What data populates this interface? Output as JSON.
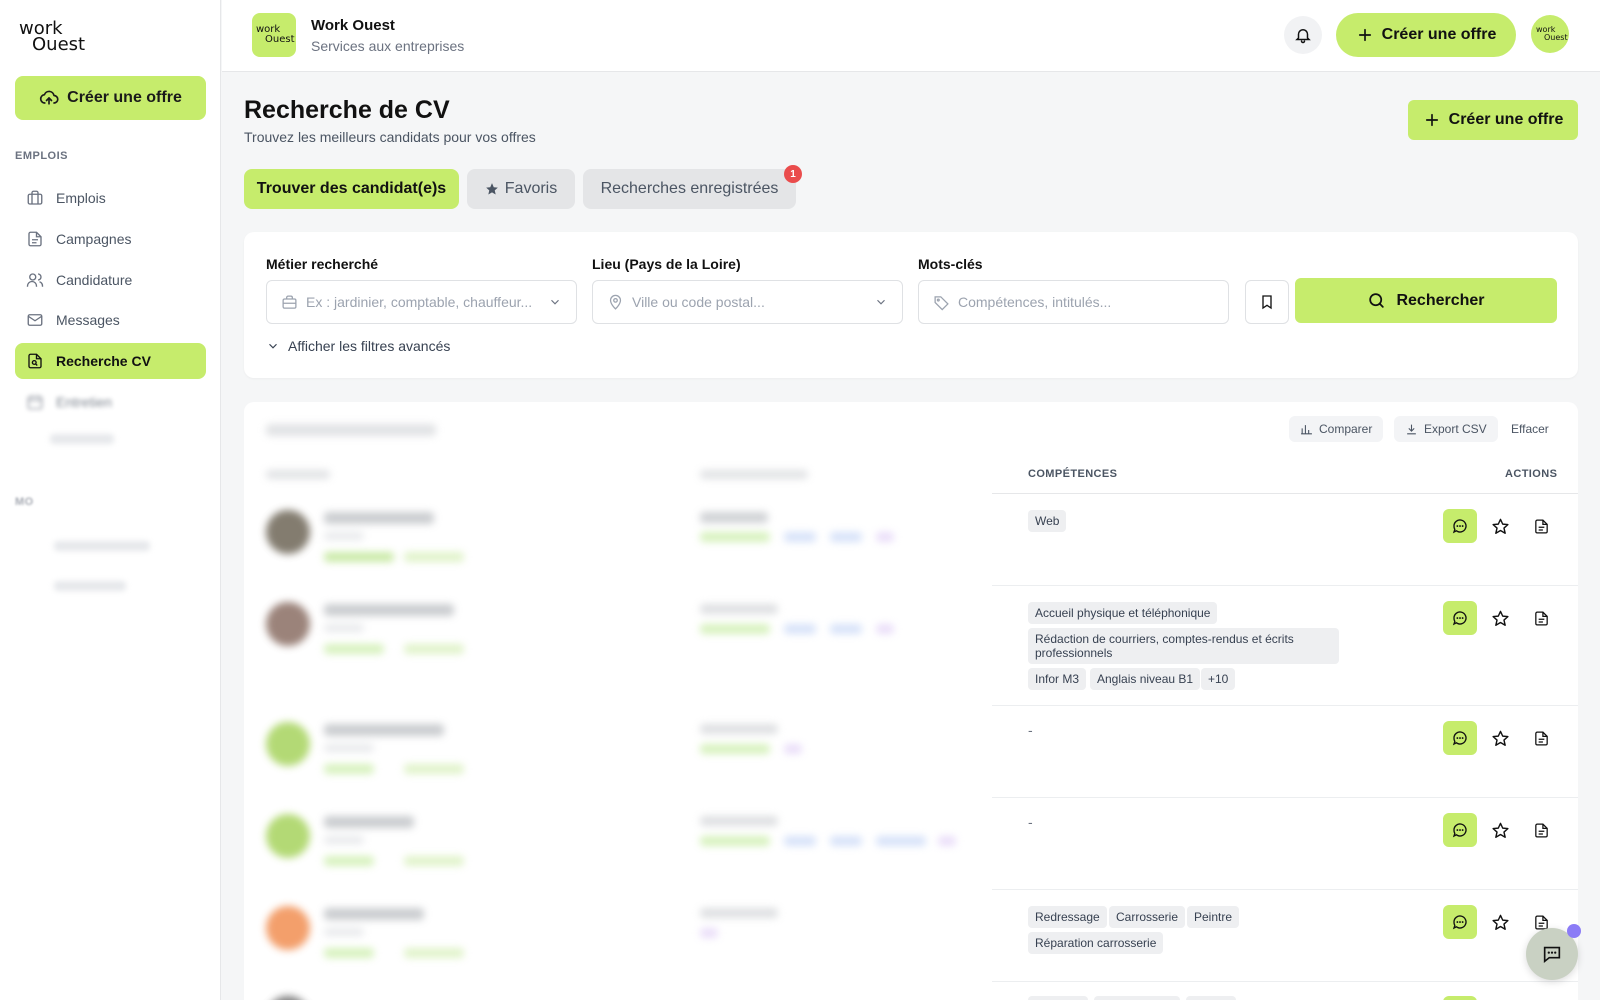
{
  "sidebar": {
    "logo_line1": "work",
    "logo_line2": "Ouest",
    "create_label": "Créer une offre",
    "section_jobs": "EMPLOIS",
    "section_account": "MO",
    "items": [
      {
        "label": "Emplois",
        "icon": "briefcase-icon"
      },
      {
        "label": "Campagnes",
        "icon": "document-icon"
      },
      {
        "label": "Candidature",
        "icon": "users-icon"
      },
      {
        "label": "Messages",
        "icon": "mail-icon"
      },
      {
        "label": "Recherche CV",
        "icon": "search-file-icon",
        "active": true
      },
      {
        "label": "Entretien",
        "icon": "calendar-icon"
      }
    ]
  },
  "header": {
    "logo_line1": "work",
    "logo_line2": "Ouest",
    "company_name": "Work Ouest",
    "company_subtitle": "Services aux entreprises",
    "create_label": "Créer une offre"
  },
  "page": {
    "title": "Recherche de CV",
    "subtitle": "Trouvez les meilleurs candidats pour vos offres",
    "create_label": "Créer une offre"
  },
  "tabs": [
    {
      "label": "Trouver des candidat(e)s",
      "active": true
    },
    {
      "label": "Favoris",
      "active": false
    },
    {
      "label": "Recherches enregistrées",
      "active": false,
      "badge": "1"
    }
  ],
  "search": {
    "job_label": "Métier recherché",
    "job_placeholder": "Ex : jardinier, comptable, chauffeur...",
    "location_label": "Lieu (Pays de la Loire)",
    "location_placeholder": "Ville ou code postal...",
    "keywords_label": "Mots-clés",
    "keywords_placeholder": "Compétences, intitulés...",
    "search_label": "Rechercher",
    "advanced_label": "Afficher les filtres avancés"
  },
  "results": {
    "compare_label": "Comparer",
    "export_label": "Export CSV",
    "clear_label": "Effacer",
    "columns": {
      "skills": "COMPÉTENCES",
      "actions": "ACTIONS"
    },
    "rows": [
      {
        "skills": [
          "Web"
        ],
        "more": ""
      },
      {
        "skills": [
          "Accueil physique et téléphonique",
          "Rédaction de courriers, comptes-rendus et écrits professionnels",
          "Infor M3",
          "Anglais niveau B1"
        ],
        "more": "+10"
      },
      {
        "skills": [],
        "empty": "-"
      },
      {
        "skills": [],
        "empty": "-"
      },
      {
        "skills": [
          "Redressage",
          "Carrosserie",
          "Peintre",
          "Réparation carrosserie"
        ],
        "more": ""
      }
    ]
  },
  "colors": {
    "accent": "#c6ec6c",
    "badge": "#ea4c4c",
    "chat_dot": "#8b7cf6"
  }
}
